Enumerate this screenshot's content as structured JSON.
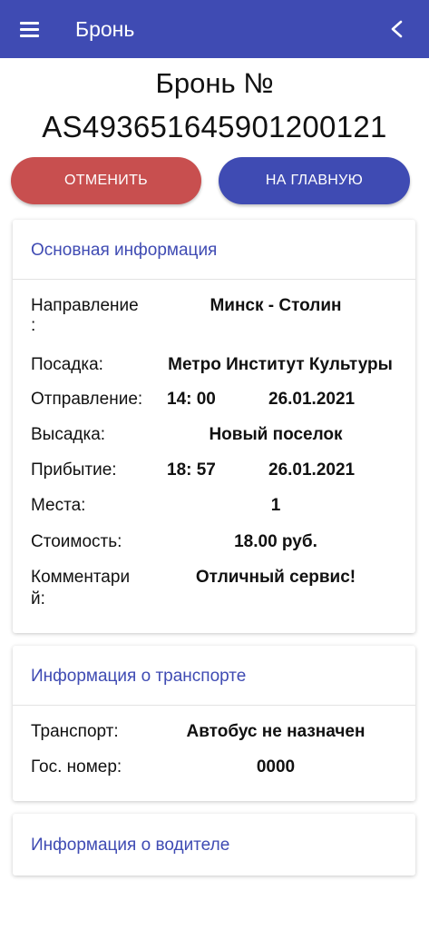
{
  "appbar": {
    "title": "Бронь"
  },
  "booking": {
    "title_line1": "Бронь №",
    "number": "AS4936516459012001​21"
  },
  "actions": {
    "cancel_label": "ОТМЕНИТЬ",
    "home_label": "НА ГЛАВНУЮ"
  },
  "main_info": {
    "title": "Основная информация",
    "direction_label_1": "Направление",
    "direction_label_2": ":",
    "direction": "Минск - Столин",
    "boarding_label": "Посадка:",
    "boarding": "Метро Институт Культуры",
    "departure_label": "Отправление:",
    "departure_time": "14: 00",
    "departure_date": "26.01.2021",
    "dropoff_label": "Высадка:",
    "dropoff": "Новый поселок",
    "arrival_label": "Прибытие:",
    "arrival_time": "18: 57",
    "arrival_date": "26.01.2021",
    "seats_label": "Места:",
    "seats": "1",
    "cost_label": "Стоимость:",
    "cost": "18.00 руб.",
    "comment_label_1": "Комментари",
    "comment_label_2": "й:",
    "comment": "Отличный сервис!"
  },
  "transport_info": {
    "title": "Информация о транспорте",
    "transport_label": "Транспорт:",
    "transport": "Автобус не назначен",
    "plate_label": "Гос. номер:",
    "plate": "0000"
  },
  "driver_info": {
    "title": "Информация о водителе"
  },
  "icons": {
    "menu": "menu-icon",
    "back": "chevron-left-icon"
  },
  "colors": {
    "primary": "#3f4bb3",
    "danger": "#c84f4f"
  }
}
